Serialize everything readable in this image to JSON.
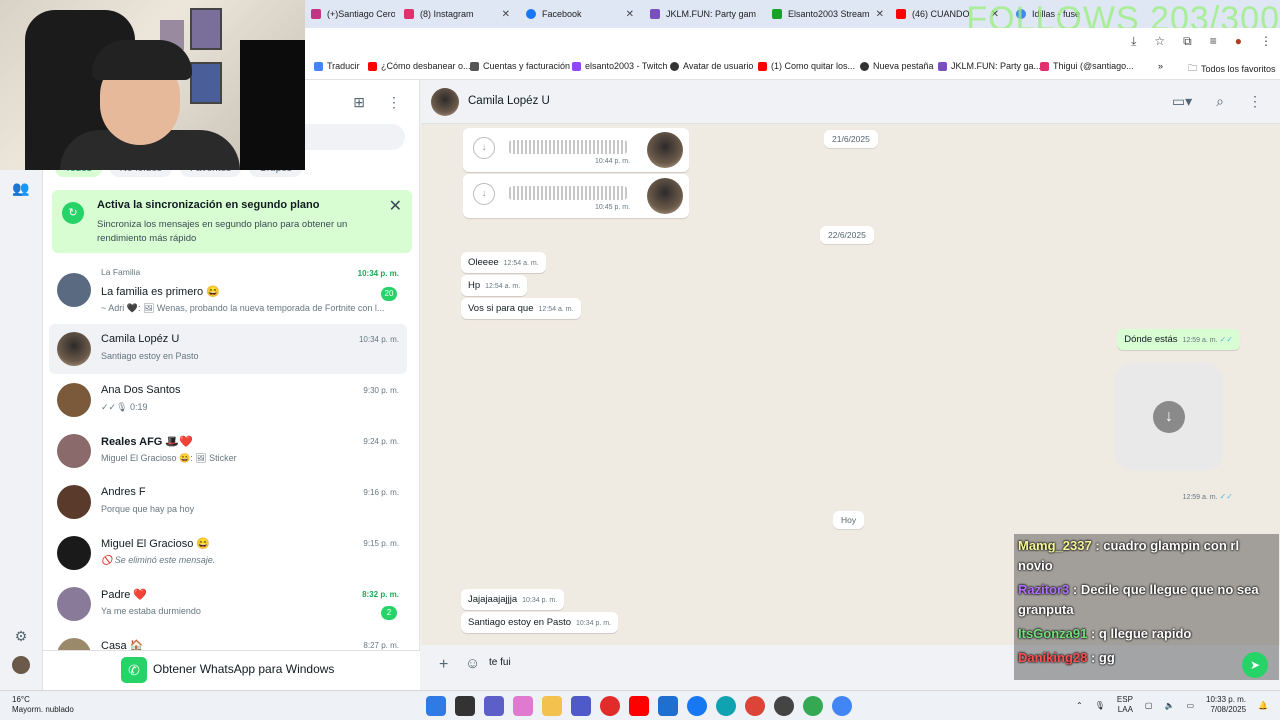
{
  "browser": {
    "tabs": [
      {
        "label": "(+)Santiago Ceron",
        "color": "#c13584"
      },
      {
        "label": "(8) Instagram",
        "color": "#e1306c"
      },
      {
        "label": "Facebook",
        "color": "#1877f2"
      },
      {
        "label": "JKLM.FUN: Party gam",
        "color": "#7a4fc0"
      },
      {
        "label": "Elsanto2003 Stream",
        "color": "#1aa12d"
      },
      {
        "label": "(46) CUANDO",
        "color": "#ff0000"
      },
      {
        "label": "Idillas - fuse",
        "color": "#4285f4"
      }
    ],
    "overlay_text": "FOLLOWS 203/300",
    "bookmarks": [
      {
        "label": "Traducir",
        "color": "#4285f4"
      },
      {
        "label": "¿Cómo desbanear o...",
        "color": "#ff0000"
      },
      {
        "label": "Cuentas y facturación",
        "color": "#555555"
      },
      {
        "label": "elsanto2003 - Twitch",
        "color": "#9146ff"
      },
      {
        "label": "Avatar de usuario",
        "color": "#333333"
      },
      {
        "label": "(1) Como quitar los...",
        "color": "#ff0000"
      },
      {
        "label": "Nueva pestaña",
        "color": "#333333"
      },
      {
        "label": "JKLM.FUN: Party ga...",
        "color": "#7a4fc0"
      },
      {
        "label": "Thigui (@santiago...",
        "color": "#e1306c"
      }
    ],
    "all_favorites": "Todos los favoritos"
  },
  "sidebar": {
    "filters": [
      "Todos",
      "No leídos",
      "Favoritos",
      "Grupos"
    ],
    "sync": {
      "title": "Activa la sincronización en segundo plano",
      "desc": "Sincroniza los mensajes en segundo plano para obtener un rendimiento más rápido"
    },
    "chats": [
      {
        "group": "La Familia",
        "name": "La familia es primero 😄",
        "preview": "~ Adri 🖤: 🖼 Wenas, probando la nueva temporada de Fortnite con l...",
        "time": "10:34 p. m.",
        "badge": "20",
        "green": true,
        "color": "#5a6a80"
      },
      {
        "group": "",
        "name": "Camila Lopéz U",
        "preview": "Santiago estoy en Pasto",
        "time": "10:34 p. m.",
        "badge": "",
        "green": false,
        "color": "#6b5a4a",
        "selected": true
      },
      {
        "group": "",
        "name": "Ana Dos Santos",
        "preview": "✓✓🎙 0:19",
        "time": "9:30 p. m.",
        "badge": "",
        "green": false,
        "color": "#7a5a3a"
      },
      {
        "group": "",
        "name": "Reales AFG 🎩❤️",
        "preview": "Miguel El Gracioso 😄: 🖼 Sticker",
        "time": "9:24 p. m.",
        "badge": "",
        "green": false,
        "color": "#8a6a6a"
      },
      {
        "group": "",
        "name": "Andres F",
        "preview": "Porque que hay pa hoy",
        "time": "9:16 p. m.",
        "badge": "",
        "green": false,
        "color": "#5a3a2a"
      },
      {
        "group": "",
        "name": "Miguel El Gracioso 😄",
        "preview": "🚫 Se eliminó este mensaje.",
        "time": "9:15 p. m.",
        "badge": "",
        "green": false,
        "color": "#1a1a1a"
      },
      {
        "group": "",
        "name": "Padre ❤️",
        "preview": "Ya me estaba durmiendo",
        "time": "8:32 p. m.",
        "badge": "2",
        "green": true,
        "color": "#8a7a9a"
      },
      {
        "group": "",
        "name": "Casa 🏠",
        "preview": "",
        "time": "8:27 p. m.",
        "badge": "",
        "green": false,
        "color": "#9a8a6a"
      }
    ],
    "get_app": "Obtener WhatsApp para Windows"
  },
  "conversation": {
    "contact": "Camila Lopéz U",
    "audios": [
      {
        "time": "10:44 p. m."
      },
      {
        "time": "10:45 p. m."
      }
    ],
    "dates": [
      "21/6/2025",
      "22/6/2025",
      "Hoy"
    ],
    "incoming_1": [
      {
        "text": "Oleeee",
        "time": "12:54 a. m."
      },
      {
        "text": "Hp",
        "time": "12:54 a. m."
      },
      {
        "text": "Vos si para que",
        "time": "12:54 a. m."
      }
    ],
    "outgoing": {
      "text": "Dónde estás",
      "time": "12:59 a. m."
    },
    "sticker_time": "12:59 a. m.",
    "incoming_2": [
      {
        "text": "Jajajaajajjja",
        "time": "10:34 p. m."
      },
      {
        "text": "Santiago estoy en Pasto",
        "time": "10:34 p. m."
      }
    ],
    "composer_value": "te fui"
  },
  "twitch_chat": [
    {
      "user": "Mamg_2337",
      "user_color": "#f5f59a",
      "msg": "cuadro glampin con rl novio"
    },
    {
      "user": "Razitor3",
      "user_color": "#b070ff",
      "msg": "Decile que llegue que no sea granputa"
    },
    {
      "user": "ItsGonza91",
      "user_color": "#6fe07a",
      "msg": "q llegue rapido"
    },
    {
      "user": "Daniking28",
      "user_color": "#ff5050",
      "msg": "gg"
    }
  ],
  "taskbar": {
    "temp": "16°C",
    "weather": "Mayorm. nublado",
    "lang": "ESP",
    "lang2": "LAA",
    "time": "10:33 p. m.",
    "date": "7/08/2025"
  }
}
